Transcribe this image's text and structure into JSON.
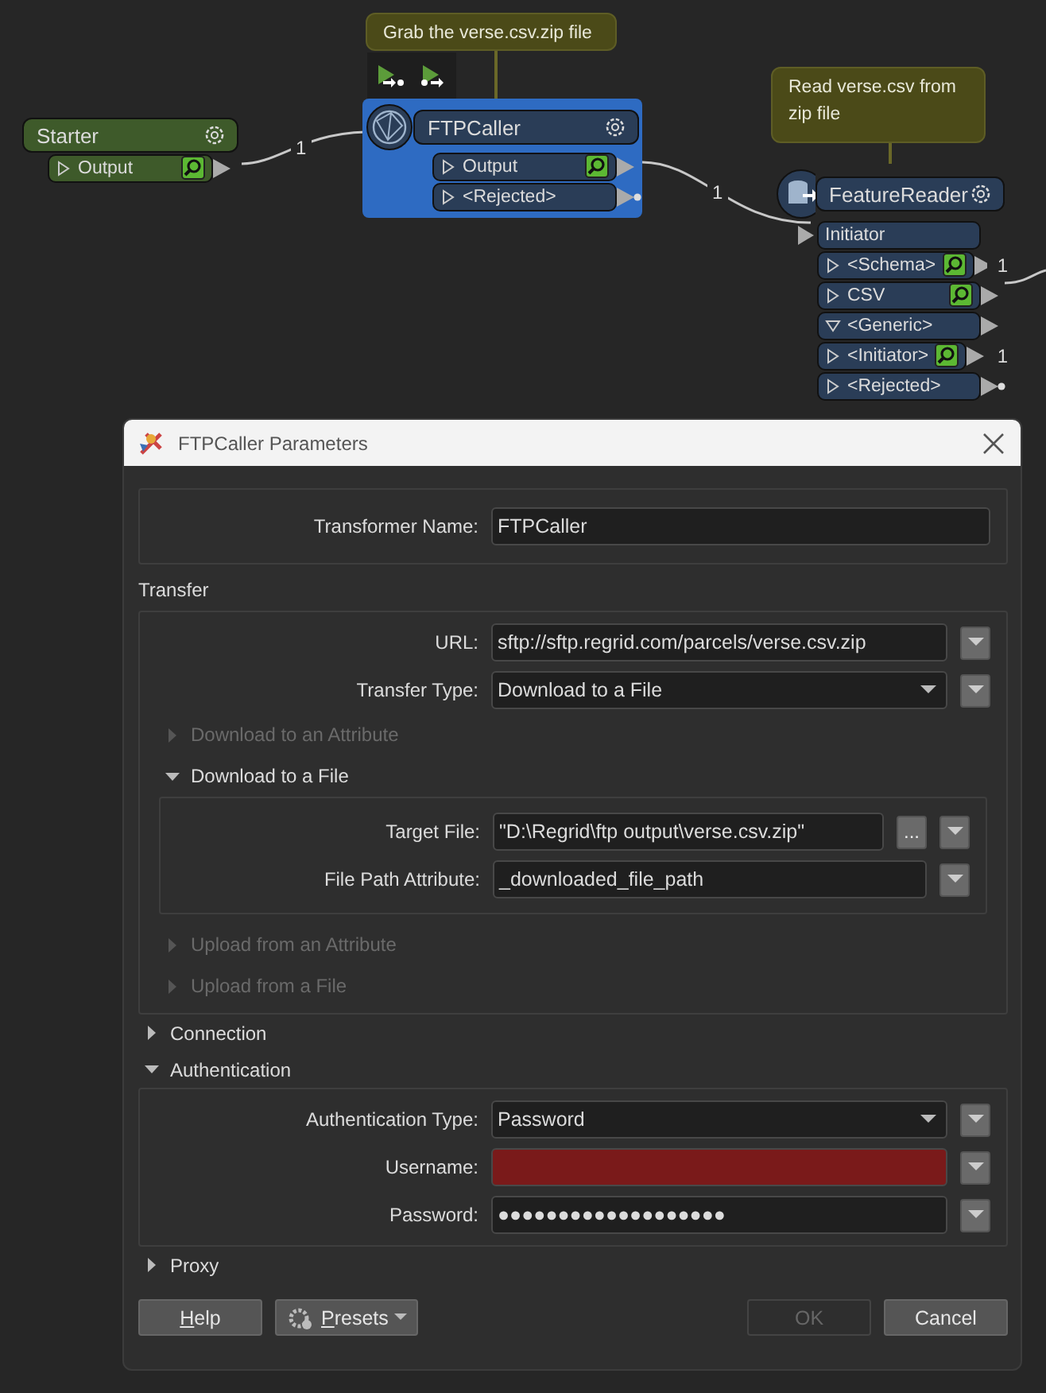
{
  "canvas": {
    "annotations": [
      {
        "text": "Grab the verse.csv.zip file"
      },
      {
        "text": "Read verse.csv from zip file"
      }
    ],
    "nodes": [
      {
        "name": "Starter",
        "kind": "starter",
        "selected": false,
        "ports": [
          {
            "label": "Output",
            "kind": "output",
            "expanded": false,
            "inspect": true
          }
        ]
      },
      {
        "name": "FTPCaller",
        "kind": "transformer",
        "selected": true,
        "ports": [
          {
            "label": "Output",
            "kind": "output",
            "expanded": false,
            "inspect": true
          },
          {
            "label": "<Rejected>",
            "kind": "rejected",
            "expanded": false,
            "inspect": false
          }
        ]
      },
      {
        "name": "FeatureReader",
        "kind": "reader",
        "selected": false,
        "ports": [
          {
            "label": "Initiator",
            "kind": "input"
          },
          {
            "label": "<Schema>",
            "kind": "output",
            "expanded": false,
            "inspect": true,
            "count": "1"
          },
          {
            "label": "CSV",
            "kind": "output",
            "expanded": false,
            "inspect": true
          },
          {
            "label": "<Generic>",
            "kind": "output",
            "expanded": true,
            "inspect": false
          },
          {
            "label": "<Initiator>",
            "kind": "output",
            "expanded": false,
            "inspect": true,
            "count": "1"
          },
          {
            "label": "<Rejected>",
            "kind": "rejected",
            "expanded": false,
            "inspect": false
          }
        ]
      }
    ],
    "connections": [
      {
        "count": "1"
      },
      {
        "count": "1"
      }
    ]
  },
  "dialog": {
    "title": "FTPCaller Parameters",
    "name_field": {
      "label": "Transformer Name:",
      "value": "FTPCaller"
    },
    "sections": [
      {
        "kind": "group",
        "label": "Transfer",
        "items": [
          {
            "kind": "text",
            "label": "URL:",
            "value": "sftp://sftp.regrid.com/parcels/verse.csv.zip",
            "invalid": false
          },
          {
            "kind": "select",
            "label": "Transfer Type:",
            "value": "Download to a File",
            "invalid": false
          },
          {
            "kind": "section",
            "label": "Download to an Attribute",
            "expanded": false,
            "disabled": true
          },
          {
            "kind": "section",
            "label": "Download to a File",
            "expanded": true,
            "disabled": false,
            "items": [
              {
                "kind": "file",
                "label": "Target File:",
                "value": "\"D:\\Regrid\\ftp output\\verse.csv.zip\"",
                "browse": "...",
                "invalid": false
              },
              {
                "kind": "text",
                "label": "File Path Attribute:",
                "value": "_downloaded_file_path",
                "invalid": false
              }
            ]
          },
          {
            "kind": "section",
            "label": "Upload from an Attribute",
            "expanded": false,
            "disabled": true
          },
          {
            "kind": "section",
            "label": "Upload from a File",
            "expanded": false,
            "disabled": true
          }
        ]
      },
      {
        "kind": "section",
        "label": "Connection",
        "expanded": false,
        "disabled": false
      },
      {
        "kind": "section",
        "label": "Authentication",
        "expanded": true,
        "disabled": false,
        "items": [
          {
            "kind": "select",
            "label": "Authentication Type:",
            "value": "Password",
            "invalid": false
          },
          {
            "kind": "text",
            "label": "Username:",
            "invalid": true
          },
          {
            "kind": "text",
            "label": "Password:",
            "value": "●●●●●●●●●●●●●●●●●●●",
            "invalid": false
          }
        ]
      },
      {
        "kind": "section",
        "label": "Proxy",
        "expanded": false,
        "disabled": false
      }
    ],
    "buttons": [
      {
        "label": "Help",
        "kind": "plain",
        "mnemonic": true,
        "disabled": false
      },
      {
        "label": "Presets",
        "kind": "menu",
        "mnemonic": true,
        "disabled": false
      },
      {
        "label": "OK",
        "kind": "plain",
        "mnemonic": false,
        "disabled": true
      },
      {
        "label": "Cancel",
        "kind": "plain",
        "mnemonic": false,
        "disabled": false
      }
    ]
  }
}
